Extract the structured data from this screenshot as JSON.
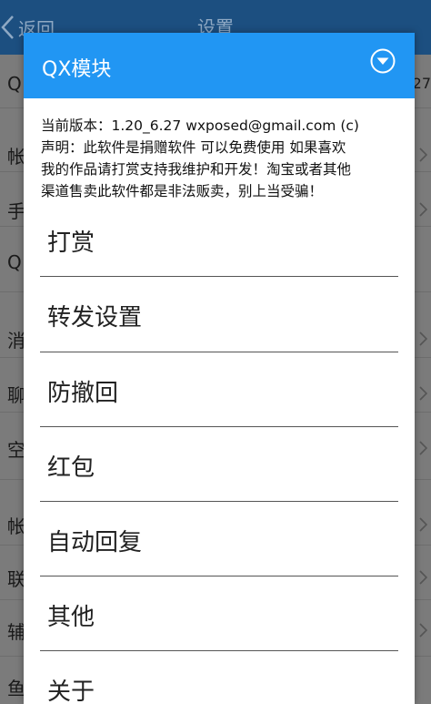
{
  "background_page": {
    "back_label": "返回",
    "title": "设置",
    "right_value": "27",
    "left_labels": [
      "Q",
      "帐",
      "手",
      "Q",
      "消",
      "聊",
      "空",
      "帐",
      "联",
      "辅",
      "鱼"
    ]
  },
  "dialog": {
    "title": "QX模块",
    "header_color": "#2196f3",
    "dropdown_icon": "chevron-down-circle-icon",
    "version_line": "当前版本：1.20_6.27 wxposed@gmail.com (c)",
    "statement_lines": [
      "声明：此软件是捐赠软件 可以免费使用 如果喜欢",
      "我的作品请打赏支持我维护和开发！淘宝或者其他",
      "渠道售卖此软件都是非法贩卖，别上当受骗！"
    ],
    "menu": [
      {
        "label": "打赏"
      },
      {
        "label": "转发设置"
      },
      {
        "label": "防撤回"
      },
      {
        "label": "红包"
      },
      {
        "label": "自动回复"
      },
      {
        "label": "其他"
      },
      {
        "label": "关于"
      }
    ]
  }
}
